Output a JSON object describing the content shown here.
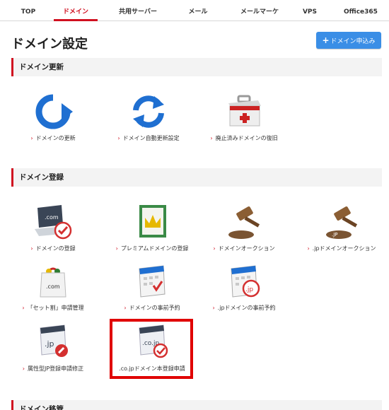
{
  "tabs": [
    {
      "label": "TOP",
      "active": false
    },
    {
      "label": "ドメイン",
      "active": true
    },
    {
      "label": "共用サーバー",
      "active": false
    },
    {
      "label": "メール",
      "active": false
    },
    {
      "label": "メールマーケ",
      "active": false
    },
    {
      "label": "VPS",
      "active": false
    },
    {
      "label": "Office365",
      "active": false
    }
  ],
  "page_title": "ドメイン設定",
  "apply_button": {
    "label": "ドメイン申込み"
  },
  "sections": {
    "renewal": {
      "title": "ドメイン更新",
      "items": [
        {
          "label": "ドメインの更新",
          "icon": "renew-icon"
        },
        {
          "label": "ドメイン自動更新設定",
          "icon": "auto-renew-icon"
        },
        {
          "label": "廃止済みドメインの復旧",
          "icon": "first-aid-icon"
        }
      ]
    },
    "registration": {
      "title": "ドメイン登録",
      "items": [
        {
          "label": "ドメインの登録",
          "icon": "laptop-com-icon"
        },
        {
          "label": "プレミアムドメインの登録",
          "icon": "premium-crown-icon"
        },
        {
          "label": "ドメインオークション",
          "icon": "gavel-icon"
        },
        {
          "label": ".jpドメインオークション",
          "icon": "gavel-jp-icon"
        },
        {
          "label": "「セット割」申請管理",
          "icon": "shopping-bag-icon"
        },
        {
          "label": "ドメインの事前予約",
          "icon": "calendar-check-icon"
        },
        {
          "label": ".jpドメインの事前予約",
          "icon": "calendar-jp-icon"
        },
        {
          "label": "属性型JP登録申請修正",
          "icon": "jp-window-edit-icon"
        },
        {
          "label": ".co.jpドメイン本登録申請",
          "icon": "cojp-window-check-icon"
        }
      ]
    },
    "transfer": {
      "title": "ドメイン移管"
    }
  },
  "colors": {
    "accent_red": "#d01020",
    "button_blue": "#3a8ee6",
    "highlight_red": "#e00000",
    "icon_blue": "#1f6fd1"
  }
}
